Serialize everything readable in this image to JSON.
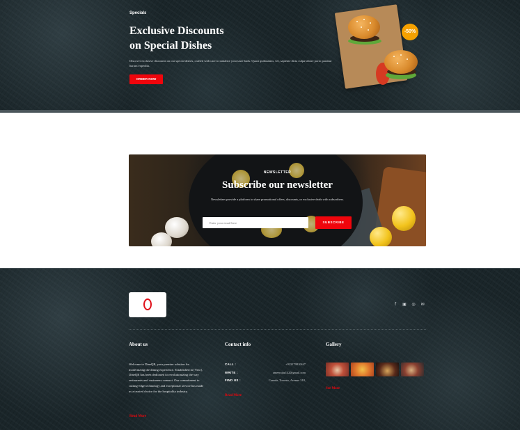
{
  "hero": {
    "tag": "Specials",
    "title_line1": "Exclusive Discounts",
    "title_line2": "on Special Dishes",
    "description": "Discover exclusive discounts on our special dishes, crafted with care to tantalize your taste buds. Quasi quibusdam, vel, sapiente dicta culpa labore porro pariatur harum expedita.",
    "order_button": "ORDER NOW",
    "discount_badge": "-50%"
  },
  "newsletter": {
    "label": "NEWSLETTER",
    "headline": "Subscribe our newsletter",
    "subtitle": "Newsletters provide a platform to share promotional offers, discounts, or exclusive deals with subscribers.",
    "email_placeholder": "Enter your email here",
    "subscribe_button": "SUBSCRIBE"
  },
  "footer": {
    "socials": [
      "facebook-icon",
      "linkedin-icon",
      "instagram-icon",
      "email-icon"
    ],
    "about": {
      "title": "About us",
      "text": "Welcome to DineQR, your premier solution for modernizing the dining experience. Established in [Year], DineQR has been dedicated to revolutionizing the way restaurants and customers connect. Our commitment to cutting-edge technology and exceptional service has made us a trusted choice for the hospitality industry.",
      "read_more": "Read More"
    },
    "contact": {
      "title": "Contact info",
      "call_label": "CALL :",
      "call_value": "+923179810447",
      "write_label": "WRITE :",
      "write_value": "ameerajaz142@gmail.com",
      "find_label": "FIND US :",
      "find_value": "Canada, Toronto, Avenue 318,",
      "read_more": "Read More"
    },
    "gallery": {
      "title": "Gallery",
      "see_more": "See More"
    }
  },
  "colors": {
    "accent_red": "#f0050c",
    "dark_bg": "#1a2529",
    "badge_orange": "#f5a100"
  }
}
